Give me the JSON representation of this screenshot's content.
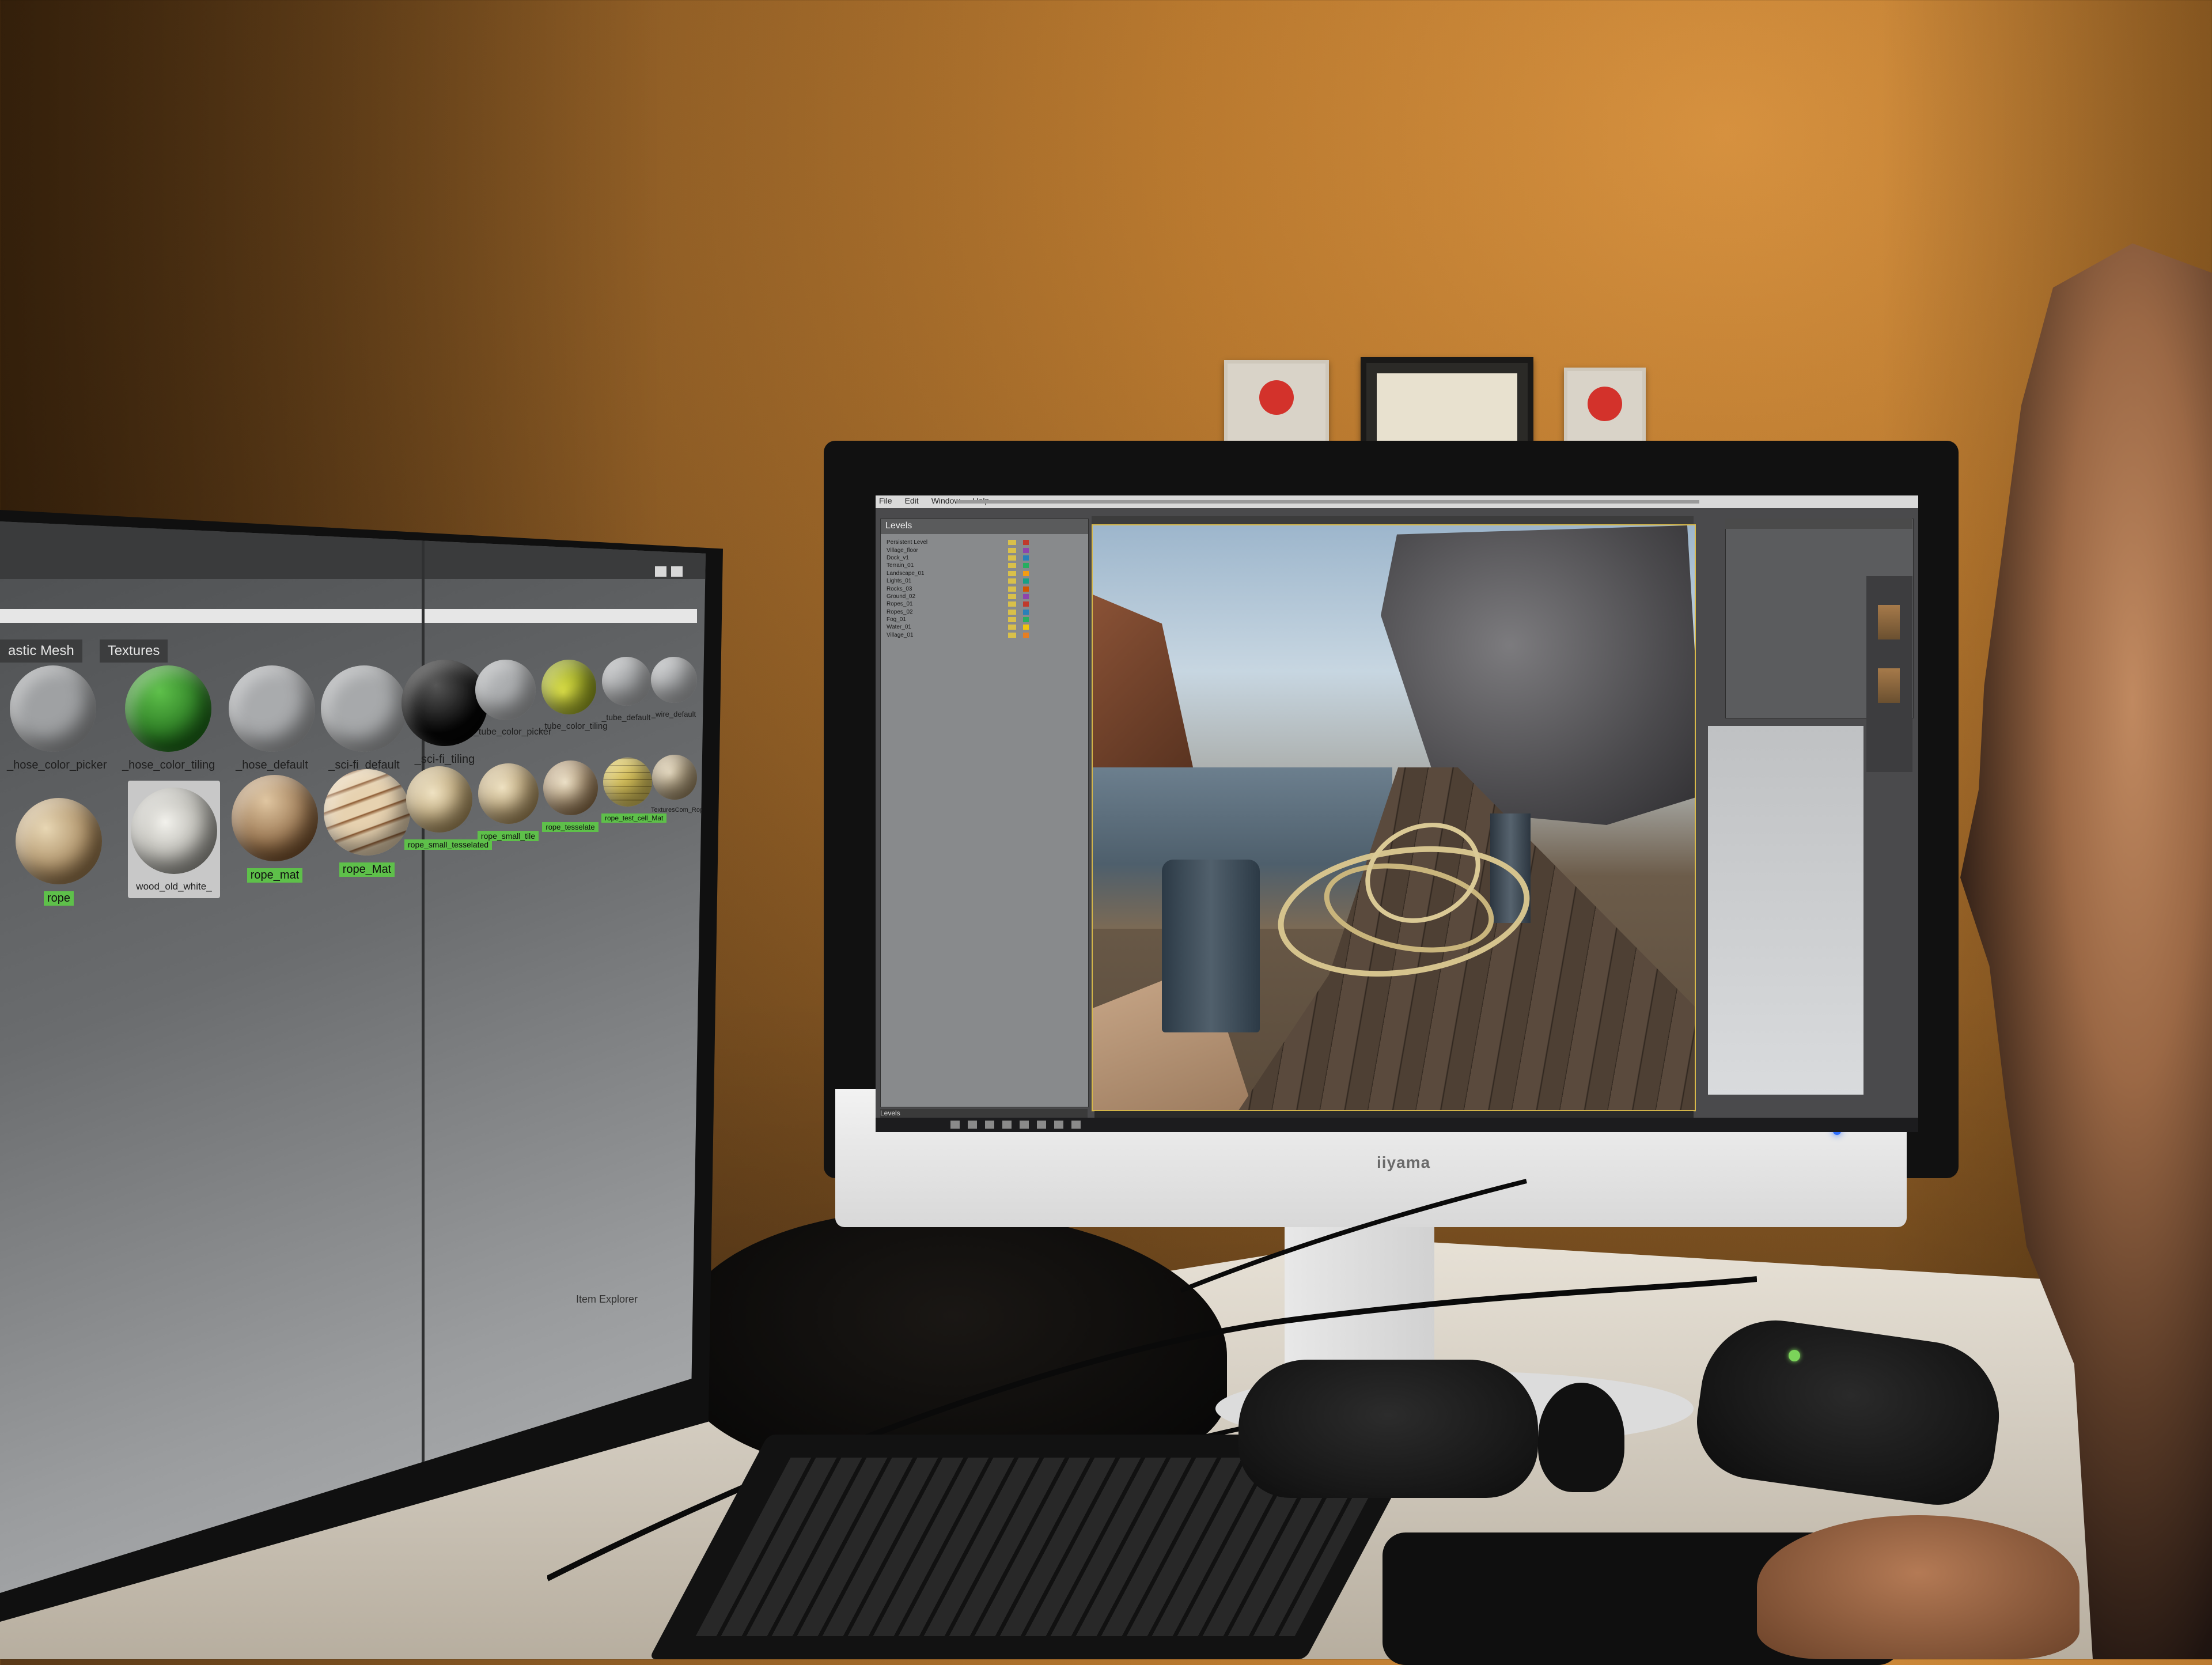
{
  "left_monitor": {
    "tabs": [
      "astic Mesh",
      "Textures"
    ],
    "materials_row1": [
      "_hose_color_picker",
      "_hose_color_tiling",
      "_hose_default",
      "_sci-fi_default",
      "_sci-fi_tiling",
      "_tube_color_picker",
      "_tube_color_tiling",
      "_tube_default",
      "_wire_default"
    ],
    "materials_row2": [
      "rope",
      "wood_old_white_",
      "rope_mat",
      "rope_Mat",
      "rope_small_tesselated",
      "rope_small_tile",
      "rope_tesselate",
      "rope_test_cell_Mat",
      "TexturesCom_Rope_"
    ],
    "status": "Item Explorer"
  },
  "right_monitor": {
    "menu": [
      "File",
      "Edit",
      "Window",
      "Help"
    ],
    "outliner_title": "Levels",
    "outliner_rows": [
      "Persistent Level",
      "Village_floor",
      "Dock_v1",
      "Terrain_01",
      "Landscape_01",
      "Lights_01",
      "Rocks_03",
      "Ground_02",
      "Ropes_01",
      "Ropes_02",
      "Fog_01",
      "Water_01",
      "Village_01"
    ],
    "outliner_footer": "Levels",
    "brand": "iiyama"
  },
  "colors": {
    "wall": "#b9792f",
    "accent_green": "#5ec04a",
    "viewport_border": "#d8b94a"
  }
}
